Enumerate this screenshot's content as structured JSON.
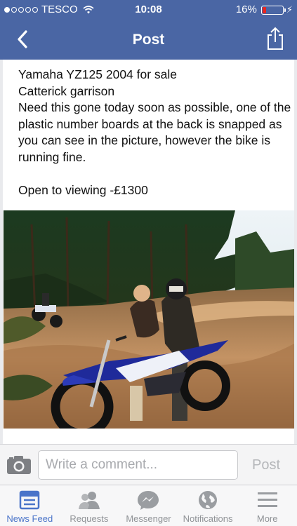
{
  "status_bar": {
    "carrier": "TESCO",
    "signal_bars_filled": 1,
    "signal_bars_total": 5,
    "time": "10:08",
    "battery_text": "16%",
    "battery_level": 0.16,
    "battery_color": "#e8251f"
  },
  "navbar": {
    "title": "Post",
    "back_icon": "chevron-left-icon",
    "share_icon": "share-icon"
  },
  "post": {
    "lines": [
      "Yamaha YZ125 2004 for sale",
      "Catterick garrison",
      "Need this gone today soon as possible, one of the plastic number boards at the back is snapped as you can see in the picture, however the bike is running fine."
    ],
    "price_line": "Open to viewing -£1300",
    "photo_description_icon": "photo-icon"
  },
  "comment_bar": {
    "camera_icon": "camera-icon",
    "placeholder": "Write a comment...",
    "post_label": "Post"
  },
  "tab_bar": {
    "active_color": "#4a74c9",
    "inactive_color": "#8f9296",
    "tabs": [
      {
        "label": "News Feed",
        "icon": "news-feed-icon",
        "active": true
      },
      {
        "label": "Requests",
        "icon": "requests-icon",
        "active": false
      },
      {
        "label": "Messenger",
        "icon": "messenger-icon",
        "active": false
      },
      {
        "label": "Notifications",
        "icon": "globe-icon",
        "active": false
      },
      {
        "label": "More",
        "icon": "menu-icon",
        "active": false
      }
    ]
  },
  "colors": {
    "header_blue": "#4a66a4"
  }
}
